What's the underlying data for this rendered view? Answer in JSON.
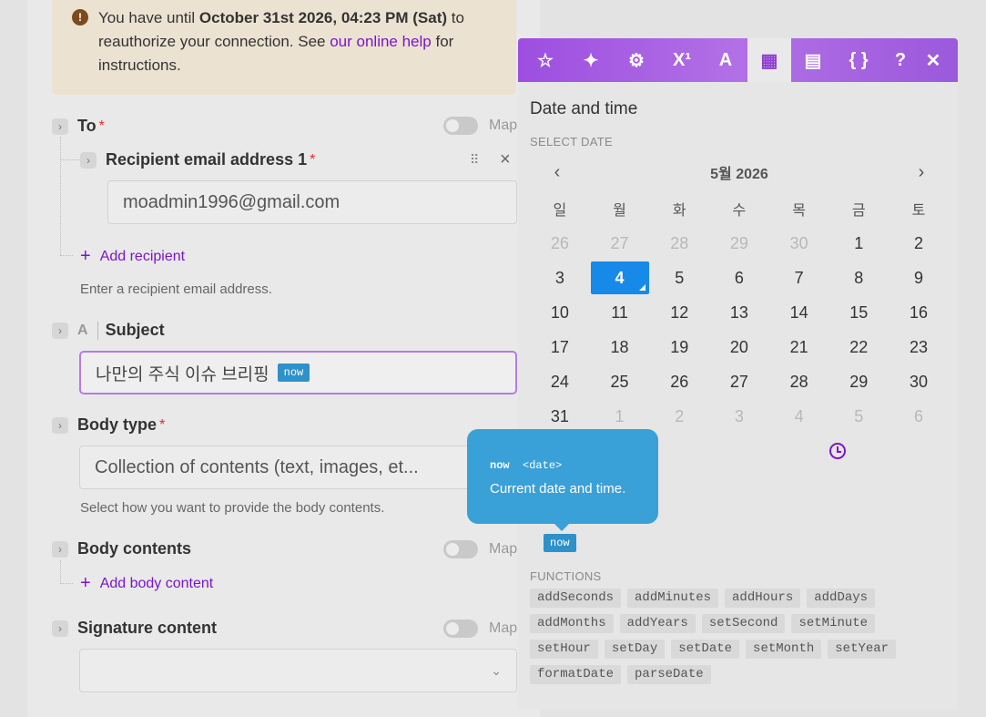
{
  "alert": {
    "prefix": "You have until ",
    "deadline": "October 31st 2026, 04:23 PM (Sat)",
    "middle": " to reauthorize your connection. See ",
    "link": "our online help",
    "suffix": " for instructions."
  },
  "form": {
    "to": {
      "label": "To",
      "required": "*",
      "map": "Map"
    },
    "recipient": {
      "label": "Recipient email address 1",
      "required": "*",
      "value": "moadmin1996@gmail.com",
      "close": "×"
    },
    "add_recipient": "Add recipient",
    "recipient_hint": "Enter a recipient email address.",
    "subject": {
      "label": "Subject",
      "value": "나만의 주식 이슈 브리핑",
      "pill": "now"
    },
    "body_type": {
      "label": "Body type",
      "required": "*",
      "value": "Collection of contents (text, images, et...",
      "hint": "Select how you want to provide the body contents."
    },
    "body_contents": {
      "label": "Body contents",
      "map": "Map"
    },
    "add_body_content": "Add body content",
    "signature": {
      "label": "Signature content",
      "map": "Map"
    }
  },
  "panel": {
    "toolbar": [
      "star-icon",
      "sparkle-icon",
      "gear-icon",
      "superscript-icon",
      "text-icon",
      "calendar-icon",
      "table-icon",
      "braces-icon",
      "help-icon",
      "close-icon"
    ],
    "toolbar_glyphs": [
      "☆",
      "✦",
      "⚙",
      "X¹",
      "A",
      "▦",
      "▤",
      "{ }",
      "?",
      "✕"
    ],
    "title": "Date and time",
    "select_date": "SELECT DATE",
    "month": "5월 2026",
    "weekdays": [
      "일",
      "월",
      "화",
      "수",
      "목",
      "금",
      "토"
    ],
    "weeks": [
      [
        "26",
        "27",
        "28",
        "29",
        "30",
        "1",
        "2"
      ],
      [
        "3",
        "4",
        "5",
        "6",
        "7",
        "8",
        "9"
      ],
      [
        "10",
        "11",
        "12",
        "13",
        "14",
        "15",
        "16"
      ],
      [
        "17",
        "18",
        "19",
        "20",
        "21",
        "22",
        "23"
      ],
      [
        "24",
        "25",
        "26",
        "27",
        "28",
        "29",
        "30"
      ],
      [
        "31",
        "1",
        "2",
        "3",
        "4",
        "5",
        "6"
      ]
    ],
    "selected": "4",
    "variable": "now",
    "functions_label": "FUNCTIONS",
    "functions": [
      "addSeconds",
      "addMinutes",
      "addHours",
      "addDays",
      "addMonths",
      "addYears",
      "setSecond",
      "setMinute",
      "setHour",
      "setDay",
      "setDate",
      "setMonth",
      "setYear",
      "formatDate",
      "parseDate"
    ]
  },
  "tooltip": {
    "name": "now",
    "type": "<date>",
    "description": "Current date and time."
  }
}
